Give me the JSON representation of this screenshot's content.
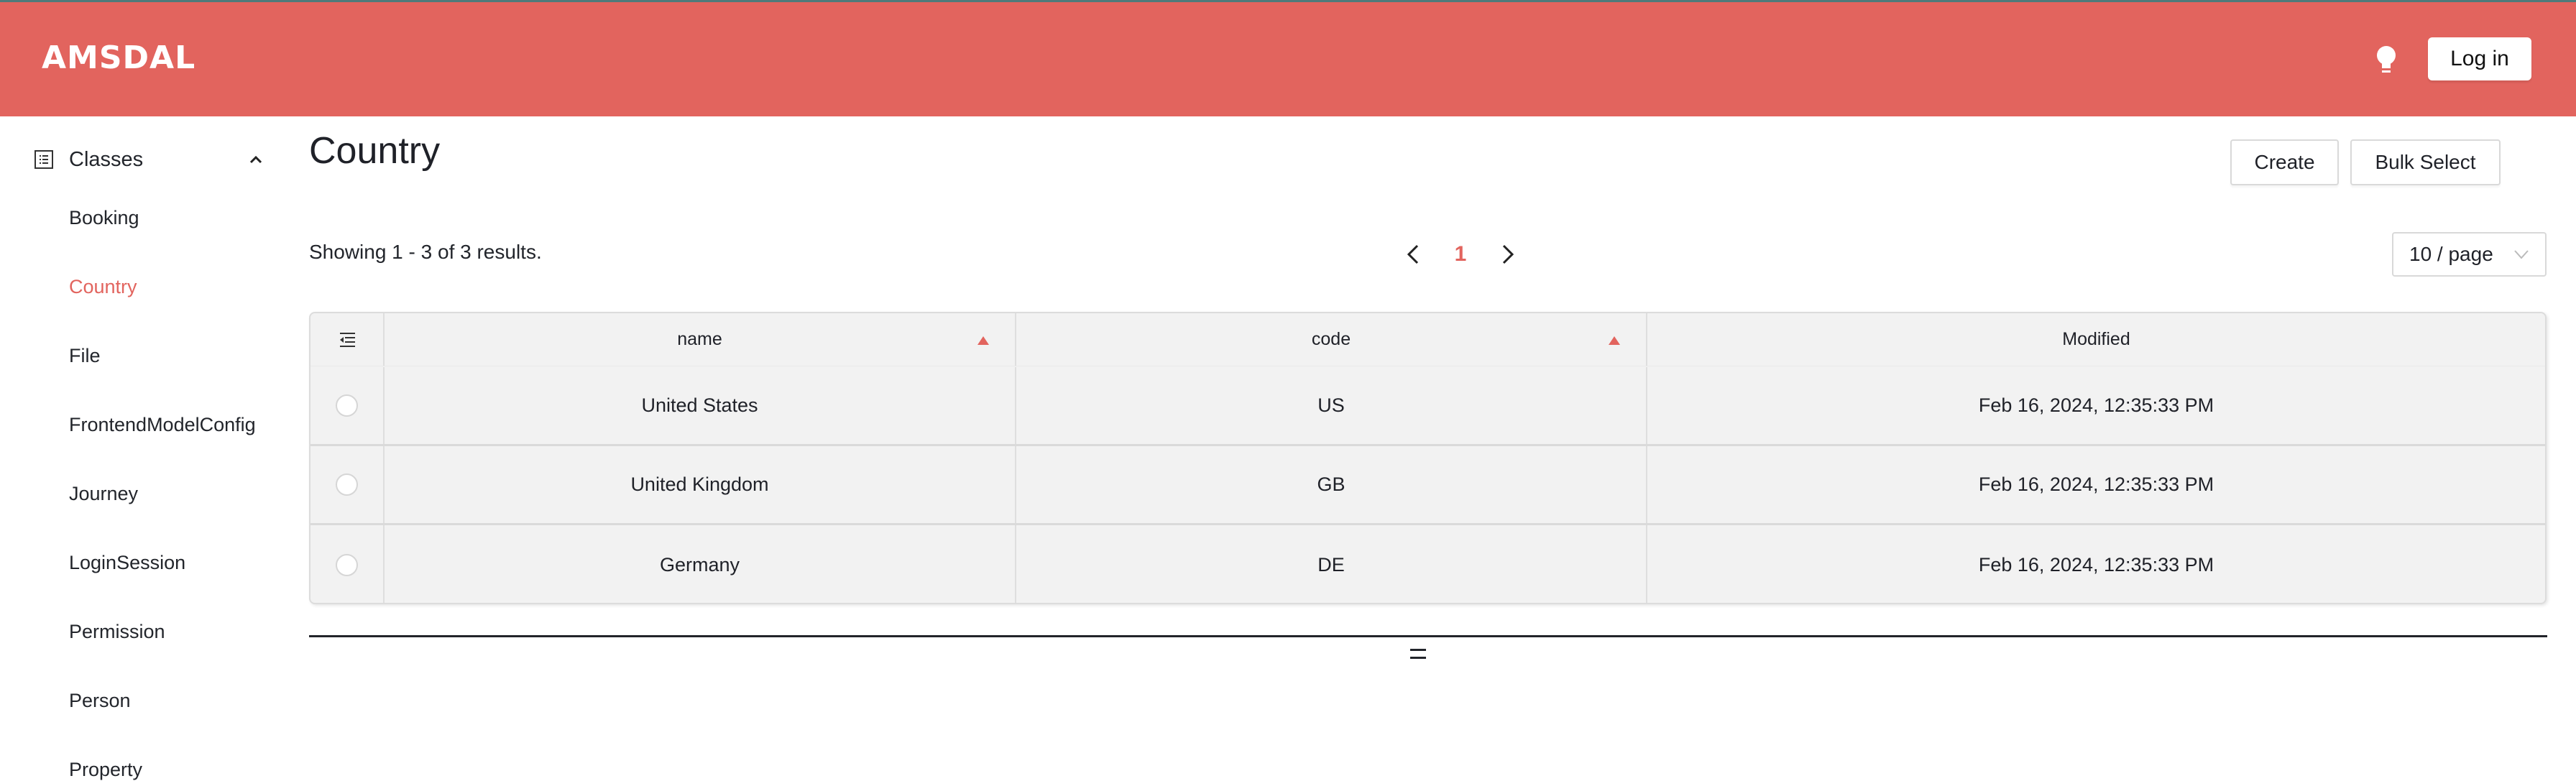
{
  "header": {
    "app_name": "AMSDAL",
    "theme_icon": "lightbulb-icon",
    "login_label": "Log in",
    "brand_color": "#e2645e"
  },
  "sidebar": {
    "group_label": "Classes",
    "group_icon": "list-icon",
    "group_expanded": true,
    "items": [
      {
        "label": "Booking",
        "active": false
      },
      {
        "label": "Country",
        "active": true
      },
      {
        "label": "File",
        "active": false
      },
      {
        "label": "FrontendModelConfig",
        "active": false
      },
      {
        "label": "Journey",
        "active": false
      },
      {
        "label": "LoginSession",
        "active": false
      },
      {
        "label": "Permission",
        "active": false
      },
      {
        "label": "Person",
        "active": false
      },
      {
        "label": "Property",
        "active": false
      }
    ]
  },
  "main": {
    "title": "Country",
    "create_label": "Create",
    "bulk_select_label": "Bulk Select",
    "showing_text": "Showing 1 - 3 of 3 results.",
    "pagination": {
      "current_page": "1"
    },
    "page_size": "10 / page",
    "table": {
      "columns": [
        {
          "label": "name",
          "sortable": true,
          "sort": "asc"
        },
        {
          "label": "code",
          "sortable": true,
          "sort": "asc"
        },
        {
          "label": "Modified",
          "sortable": false
        }
      ],
      "rows": [
        {
          "name": "United States",
          "code": "US",
          "modified": "Feb 16, 2024, 12:35:33 PM"
        },
        {
          "name": "United Kingdom",
          "code": "GB",
          "modified": "Feb 16, 2024, 12:35:33 PM"
        },
        {
          "name": "Germany",
          "code": "DE",
          "modified": "Feb 16, 2024, 12:35:33 PM"
        }
      ]
    }
  }
}
